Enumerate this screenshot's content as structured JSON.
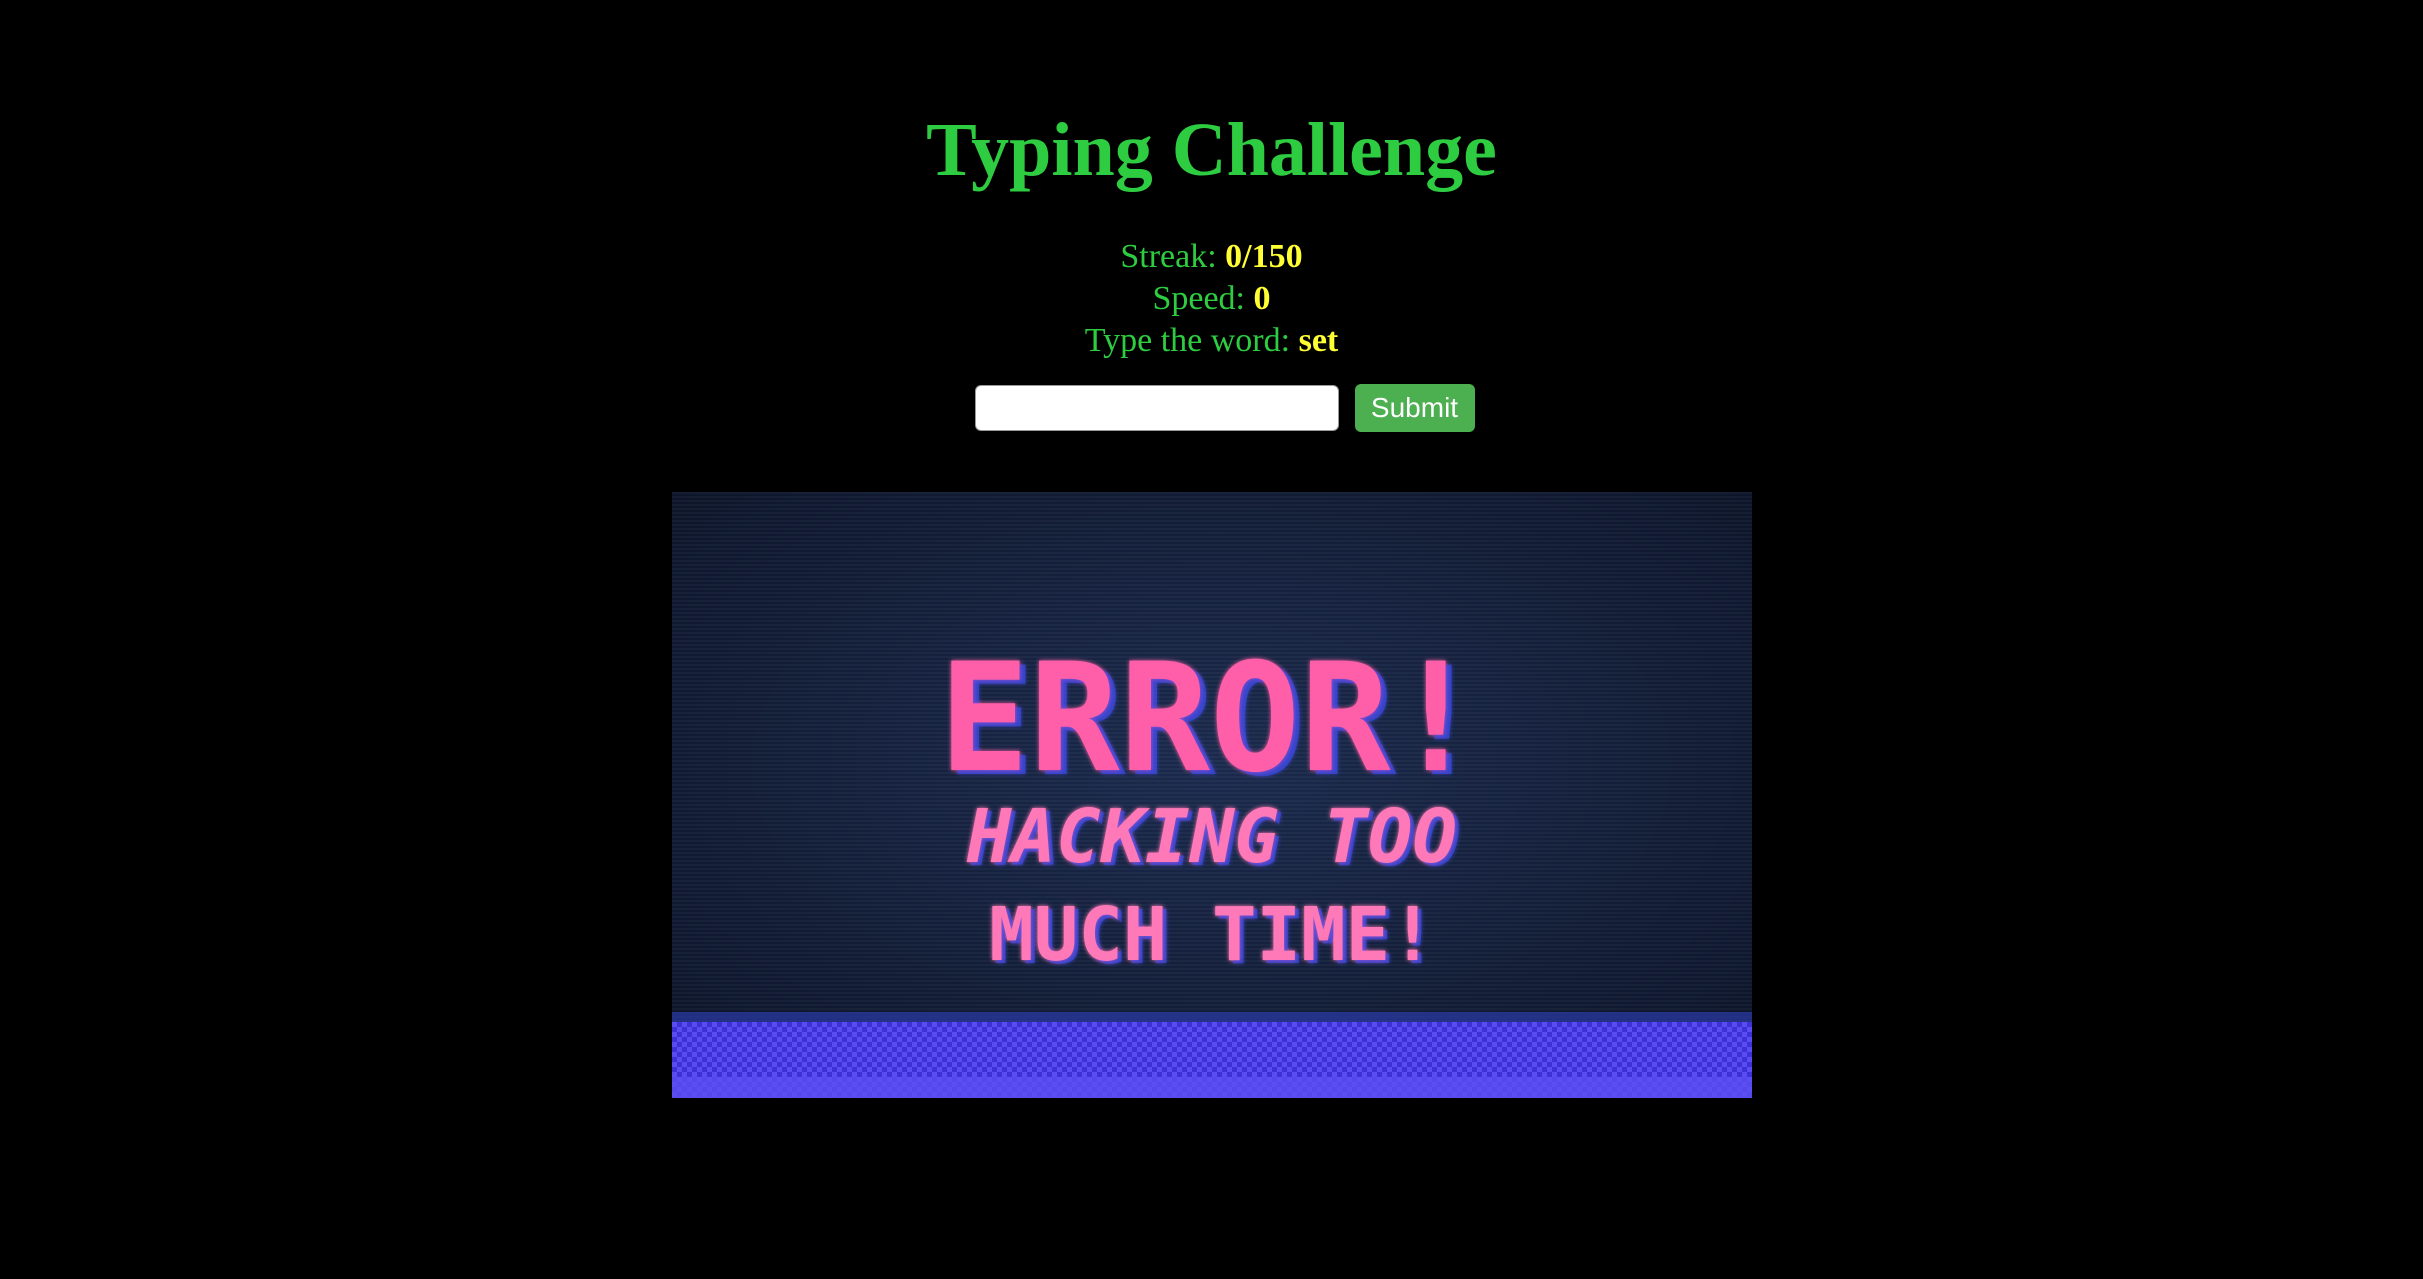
{
  "title": "Typing Challenge",
  "streak": {
    "label": "Streak: ",
    "current": "0",
    "separator": "/",
    "goal": "150"
  },
  "speed": {
    "label": "Speed: ",
    "value": "0"
  },
  "prompt": {
    "label": "Type the word: ",
    "word": "set"
  },
  "input": {
    "value": "",
    "placeholder": ""
  },
  "submit_label": "Submit",
  "image": {
    "line1": "ERROR!",
    "line2": "HACKING TOO",
    "line3": "MUCH TIME!"
  },
  "colors": {
    "background": "#000000",
    "text_green": "#2ecc40",
    "value_yellow": "#ffff33",
    "button_green": "#4caf50",
    "error_pink": "#ff5fa8",
    "screen_blue": "#4a3ae0"
  }
}
